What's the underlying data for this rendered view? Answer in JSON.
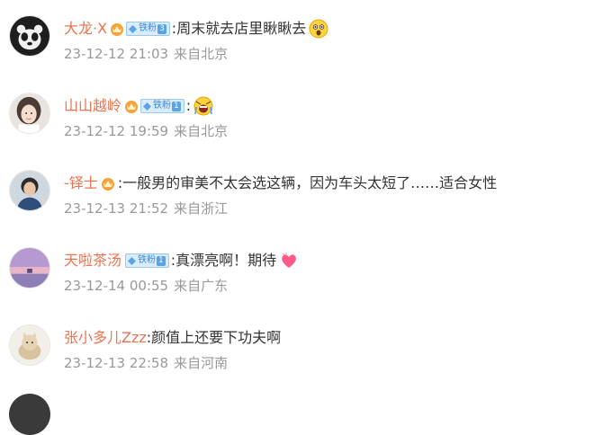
{
  "comments": [
    {
      "username": "大龙·X",
      "has_crown": true,
      "fan_badge": {
        "text": "铁粉",
        "level": "3"
      },
      "text": ":周末就去店里瞅瞅去",
      "emoji": "astonished-emoji-icon",
      "date": "23-12-12 21:03",
      "location": "来自北京",
      "avatar": "panda-avatar"
    },
    {
      "username": "山山越岭",
      "has_crown": true,
      "fan_badge": {
        "text": "铁粉",
        "level": "1"
      },
      "text": ":",
      "emoji": "screaming-emoji-icon",
      "date": "23-12-12 19:59",
      "location": "来自北京",
      "avatar": "girl-avatar"
    },
    {
      "username": "-铎士",
      "has_crown": true,
      "fan_badge": null,
      "text": ":一般男的审美不太会选这辆，因为车头太短了……适合女性",
      "emoji": null,
      "date": "23-12-13 21:52",
      "location": "来自浙江",
      "avatar": "person-avatar"
    },
    {
      "username": "天啦茶汤",
      "has_crown": false,
      "fan_badge": {
        "text": "铁粉",
        "level": "1"
      },
      "text": ":真漂亮啊！期待",
      "emoji": "heart-emoji-icon",
      "date": "23-12-14 00:55",
      "location": "来自广东",
      "avatar": "sunset-avatar"
    },
    {
      "username": "张小多儿Zzz",
      "has_crown": false,
      "fan_badge": null,
      "text": ":颜值上还要下功夫啊",
      "emoji": null,
      "date": "23-12-13 22:58",
      "location": "来自河南",
      "avatar": "cat-avatar"
    }
  ],
  "colors": {
    "username": "#eb7350",
    "text": "#333333",
    "meta": "#999999",
    "badge_bg": "#d9ecfb",
    "badge_text": "#3e8ad3"
  }
}
